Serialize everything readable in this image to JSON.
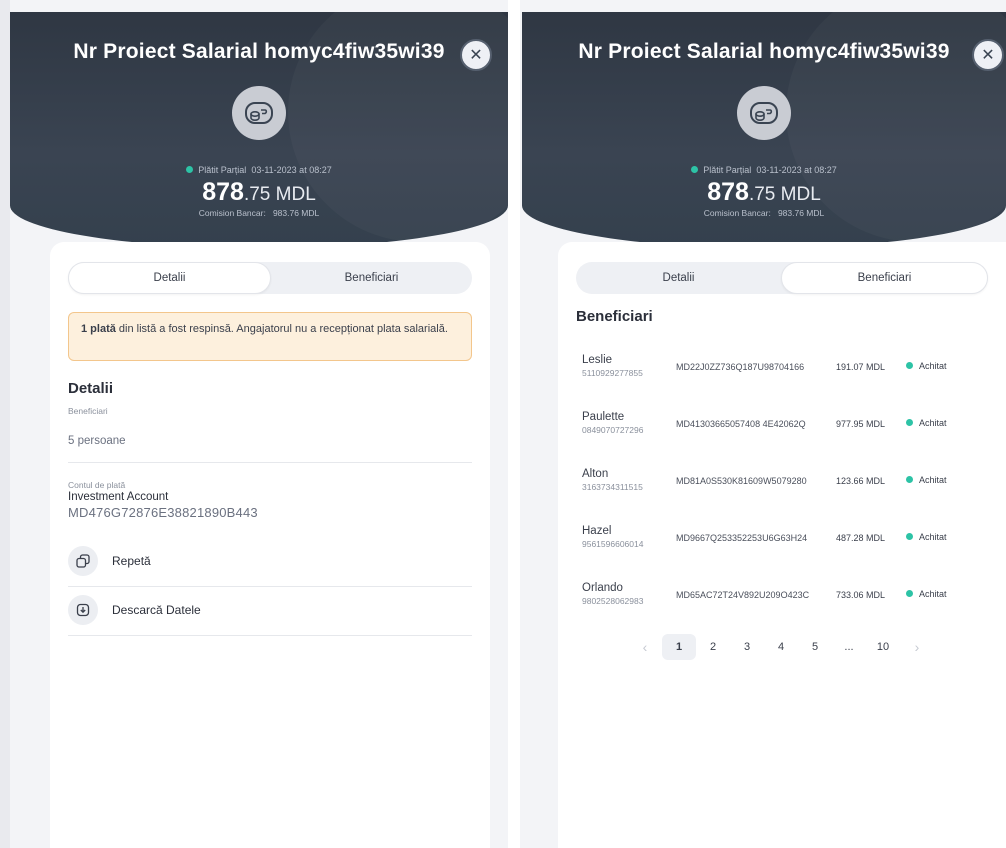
{
  "left": {
    "title": "Nr Proiect Salarial homyc4fiw35wi39",
    "status": "Plătit Parțial",
    "datetime": "03-11-2023 at 08:27",
    "amount_int": "878",
    "amount_dec": ".75 MDL",
    "commission_label": "Comision Bancar:",
    "commission_value": "983.76 MDL",
    "tabs": [
      "Detalii",
      "Beneficiari"
    ],
    "alert_bold": "1 plată",
    "alert_text": " din listă a fost respinsă. Angajatorul nu a recepționat plata salarială.",
    "details_title": "Detalii",
    "beneficiari_label": "Beneficiari",
    "beneficiari_value": "5 persoane",
    "account_label": "Contul de plată",
    "account_name": "Investment Account",
    "account_iban": "MD476G72876E38821890B443",
    "actions": [
      "Repetă",
      "Descarcă Datele"
    ]
  },
  "right": {
    "title": "Nr Proiect Salarial homyc4fiw35wi39",
    "status": "Plătit Parțial",
    "datetime": "03-11-2023 at 08:27",
    "amount_int": "878",
    "amount_dec": ".75 MDL",
    "commission_label": "Comision Bancar:",
    "commission_value": "983.76 MDL",
    "tabs": [
      "Detalii",
      "Beneficiari"
    ],
    "list_title": "Beneficiari",
    "rows": [
      {
        "name": "Leslie",
        "id": "5110929277855",
        "iban": "MD22J0ZZ736Q187U98704166",
        "amount": "191.07 MDL",
        "status": "Achitat"
      },
      {
        "name": "Paulette",
        "id": "0849070727296",
        "iban": "MD41303665057408 4E42062Q",
        "amount": "977.95 MDL",
        "status": "Achitat"
      },
      {
        "name": "Alton",
        "id": "3163734311515",
        "iban": "MD81A0S530K81609W5079280",
        "amount": "123.66 MDL",
        "status": "Achitat"
      },
      {
        "name": "Hazel",
        "id": "9561596606014",
        "iban": "MD9667Q253352253U6G63H24",
        "amount": "487.28 MDL",
        "status": "Achitat"
      },
      {
        "name": "Orlando",
        "id": "9802528062983",
        "iban": "MD65AC72T24V892U209O423C",
        "amount": "733.06 MDL",
        "status": "Achitat"
      }
    ],
    "pager": {
      "prev": "‹",
      "pages": [
        "1",
        "2",
        "3",
        "4",
        "5",
        "...",
        "10"
      ],
      "next": "›",
      "active": "1"
    }
  },
  "colors": {
    "header": "#333c48",
    "status_dot": "#2dc3a6",
    "alert_bg": "#fdf0dd",
    "alert_border": "#f3c68c"
  },
  "icons": {
    "close": "close-icon",
    "avatar": "coins-icon",
    "repeat": "copy-icon",
    "download": "download-icon"
  }
}
